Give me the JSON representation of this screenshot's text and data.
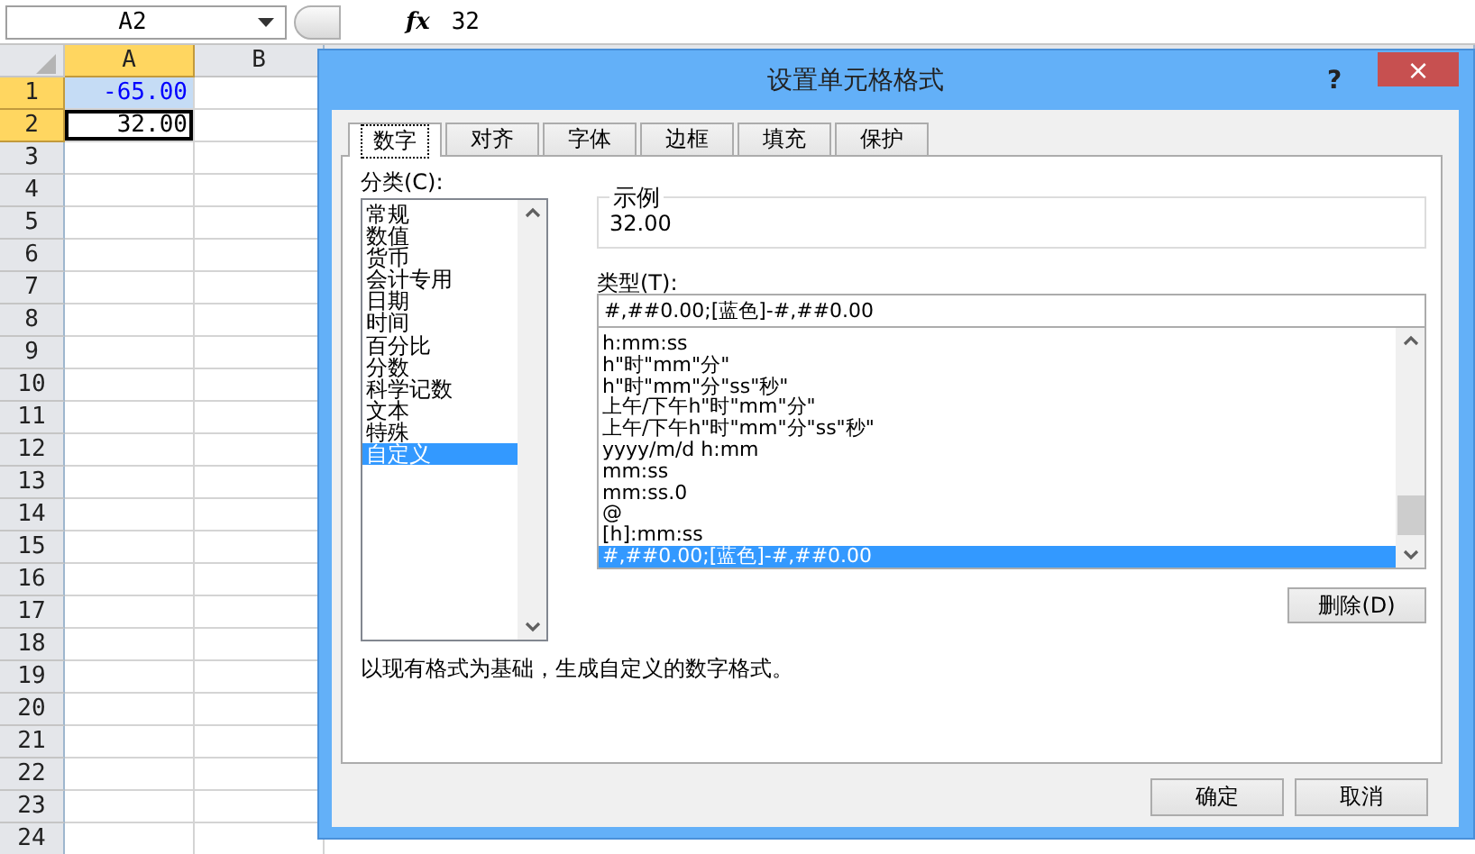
{
  "formula_bar": {
    "name_box": "A2",
    "fx": "fx",
    "value": "32"
  },
  "sheet": {
    "columns": [
      {
        "label": "A",
        "selected": true
      },
      {
        "label": "B",
        "selected": false
      }
    ],
    "rows": [
      {
        "label": "1",
        "selected": true,
        "cell_a": {
          "text": "-65.00",
          "color": "#0000ff",
          "active": false
        }
      },
      {
        "label": "2",
        "selected": true,
        "cell_a": {
          "text": "32.00",
          "color": "#000000",
          "active": true
        }
      },
      {
        "label": "3",
        "selected": false
      },
      {
        "label": "4",
        "selected": false
      },
      {
        "label": "5",
        "selected": false
      },
      {
        "label": "6",
        "selected": false
      },
      {
        "label": "7",
        "selected": false
      },
      {
        "label": "8",
        "selected": false
      },
      {
        "label": "9",
        "selected": false
      },
      {
        "label": "10",
        "selected": false
      },
      {
        "label": "11",
        "selected": false
      },
      {
        "label": "12",
        "selected": false
      },
      {
        "label": "13",
        "selected": false
      },
      {
        "label": "14",
        "selected": false
      },
      {
        "label": "15",
        "selected": false
      },
      {
        "label": "16",
        "selected": false
      },
      {
        "label": "17",
        "selected": false
      },
      {
        "label": "18",
        "selected": false
      },
      {
        "label": "19",
        "selected": false
      },
      {
        "label": "20",
        "selected": false
      },
      {
        "label": "21",
        "selected": false
      },
      {
        "label": "22",
        "selected": false
      },
      {
        "label": "23",
        "selected": false
      },
      {
        "label": "24",
        "selected": false
      }
    ]
  },
  "dialog": {
    "title": "设置单元格格式",
    "help": "?",
    "close": "×",
    "tabs": [
      {
        "label": "数字",
        "selected": true
      },
      {
        "label": "对齐",
        "selected": false
      },
      {
        "label": "字体",
        "selected": false
      },
      {
        "label": "边框",
        "selected": false
      },
      {
        "label": "填充",
        "selected": false
      },
      {
        "label": "保护",
        "selected": false
      }
    ],
    "category_label": "分类(C):",
    "categories": [
      {
        "label": "常规",
        "selected": false
      },
      {
        "label": "数值",
        "selected": false
      },
      {
        "label": "货币",
        "selected": false
      },
      {
        "label": "会计专用",
        "selected": false
      },
      {
        "label": "日期",
        "selected": false
      },
      {
        "label": "时间",
        "selected": false
      },
      {
        "label": "百分比",
        "selected": false
      },
      {
        "label": "分数",
        "selected": false
      },
      {
        "label": "科学记数",
        "selected": false
      },
      {
        "label": "文本",
        "selected": false
      },
      {
        "label": "特殊",
        "selected": false
      },
      {
        "label": "自定义",
        "selected": true
      }
    ],
    "sample": {
      "label": "示例",
      "value": "32.00"
    },
    "type_label": "类型(T):",
    "type_value": "#,##0.00;[蓝色]-#,##0.00",
    "types": [
      {
        "label": "h:mm:ss",
        "selected": false
      },
      {
        "label": "h\"时\"mm\"分\"",
        "selected": false
      },
      {
        "label": "h\"时\"mm\"分\"ss\"秒\"",
        "selected": false
      },
      {
        "label": "上午/下午h\"时\"mm\"分\"",
        "selected": false
      },
      {
        "label": "上午/下午h\"时\"mm\"分\"ss\"秒\"",
        "selected": false
      },
      {
        "label": "yyyy/m/d h:mm",
        "selected": false
      },
      {
        "label": "mm:ss",
        "selected": false
      },
      {
        "label": "mm:ss.0",
        "selected": false
      },
      {
        "label": "@",
        "selected": false
      },
      {
        "label": "[h]:mm:ss",
        "selected": false
      },
      {
        "label": "#,##0.00;[蓝色]-#,##0.00",
        "selected": true
      }
    ],
    "delete_button": "删除(D)",
    "description": "以现有格式为基础，生成自定义的数字格式。",
    "buttons": [
      "确定",
      "取消"
    ]
  }
}
